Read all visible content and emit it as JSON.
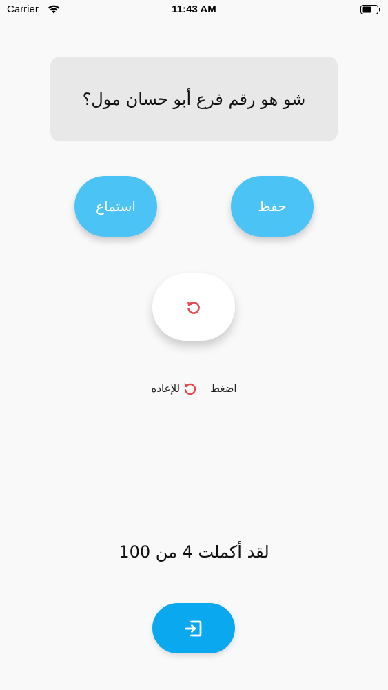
{
  "status_bar": {
    "carrier": "Carrier",
    "time": "11:43 AM",
    "icons": [
      "wifi-icon",
      "battery-icon"
    ]
  },
  "question": {
    "text": "شو هو رقم فرع أبو حسان مول؟"
  },
  "buttons": {
    "listen_label": "استماع",
    "save_label": "حفظ",
    "reset_icon": "refresh-icon",
    "exit_icon": "exit-icon"
  },
  "hint": {
    "press": "اضغط",
    "to_repeat": "للإعاده",
    "icon": "refresh-icon"
  },
  "progress": {
    "text": "لقد أكملت 4 من 100",
    "completed": 4,
    "total": 100
  },
  "colors": {
    "pill_blue": "#4cc3f5",
    "exit_blue": "#0aa9ef",
    "reset_red": "#e5474b",
    "card_gray": "#e8e8e9"
  }
}
